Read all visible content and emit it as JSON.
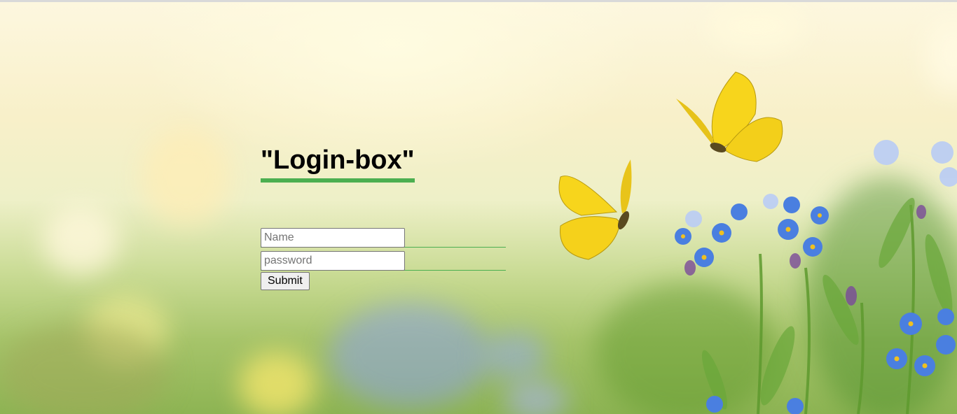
{
  "login": {
    "title": "\"Login-box\"",
    "name_placeholder": "Name",
    "password_placeholder": "password",
    "submit_label": "Submit",
    "accent_color": "#4caf50"
  },
  "background": {
    "image": "meadow-butterflies-flowers-illustration"
  }
}
